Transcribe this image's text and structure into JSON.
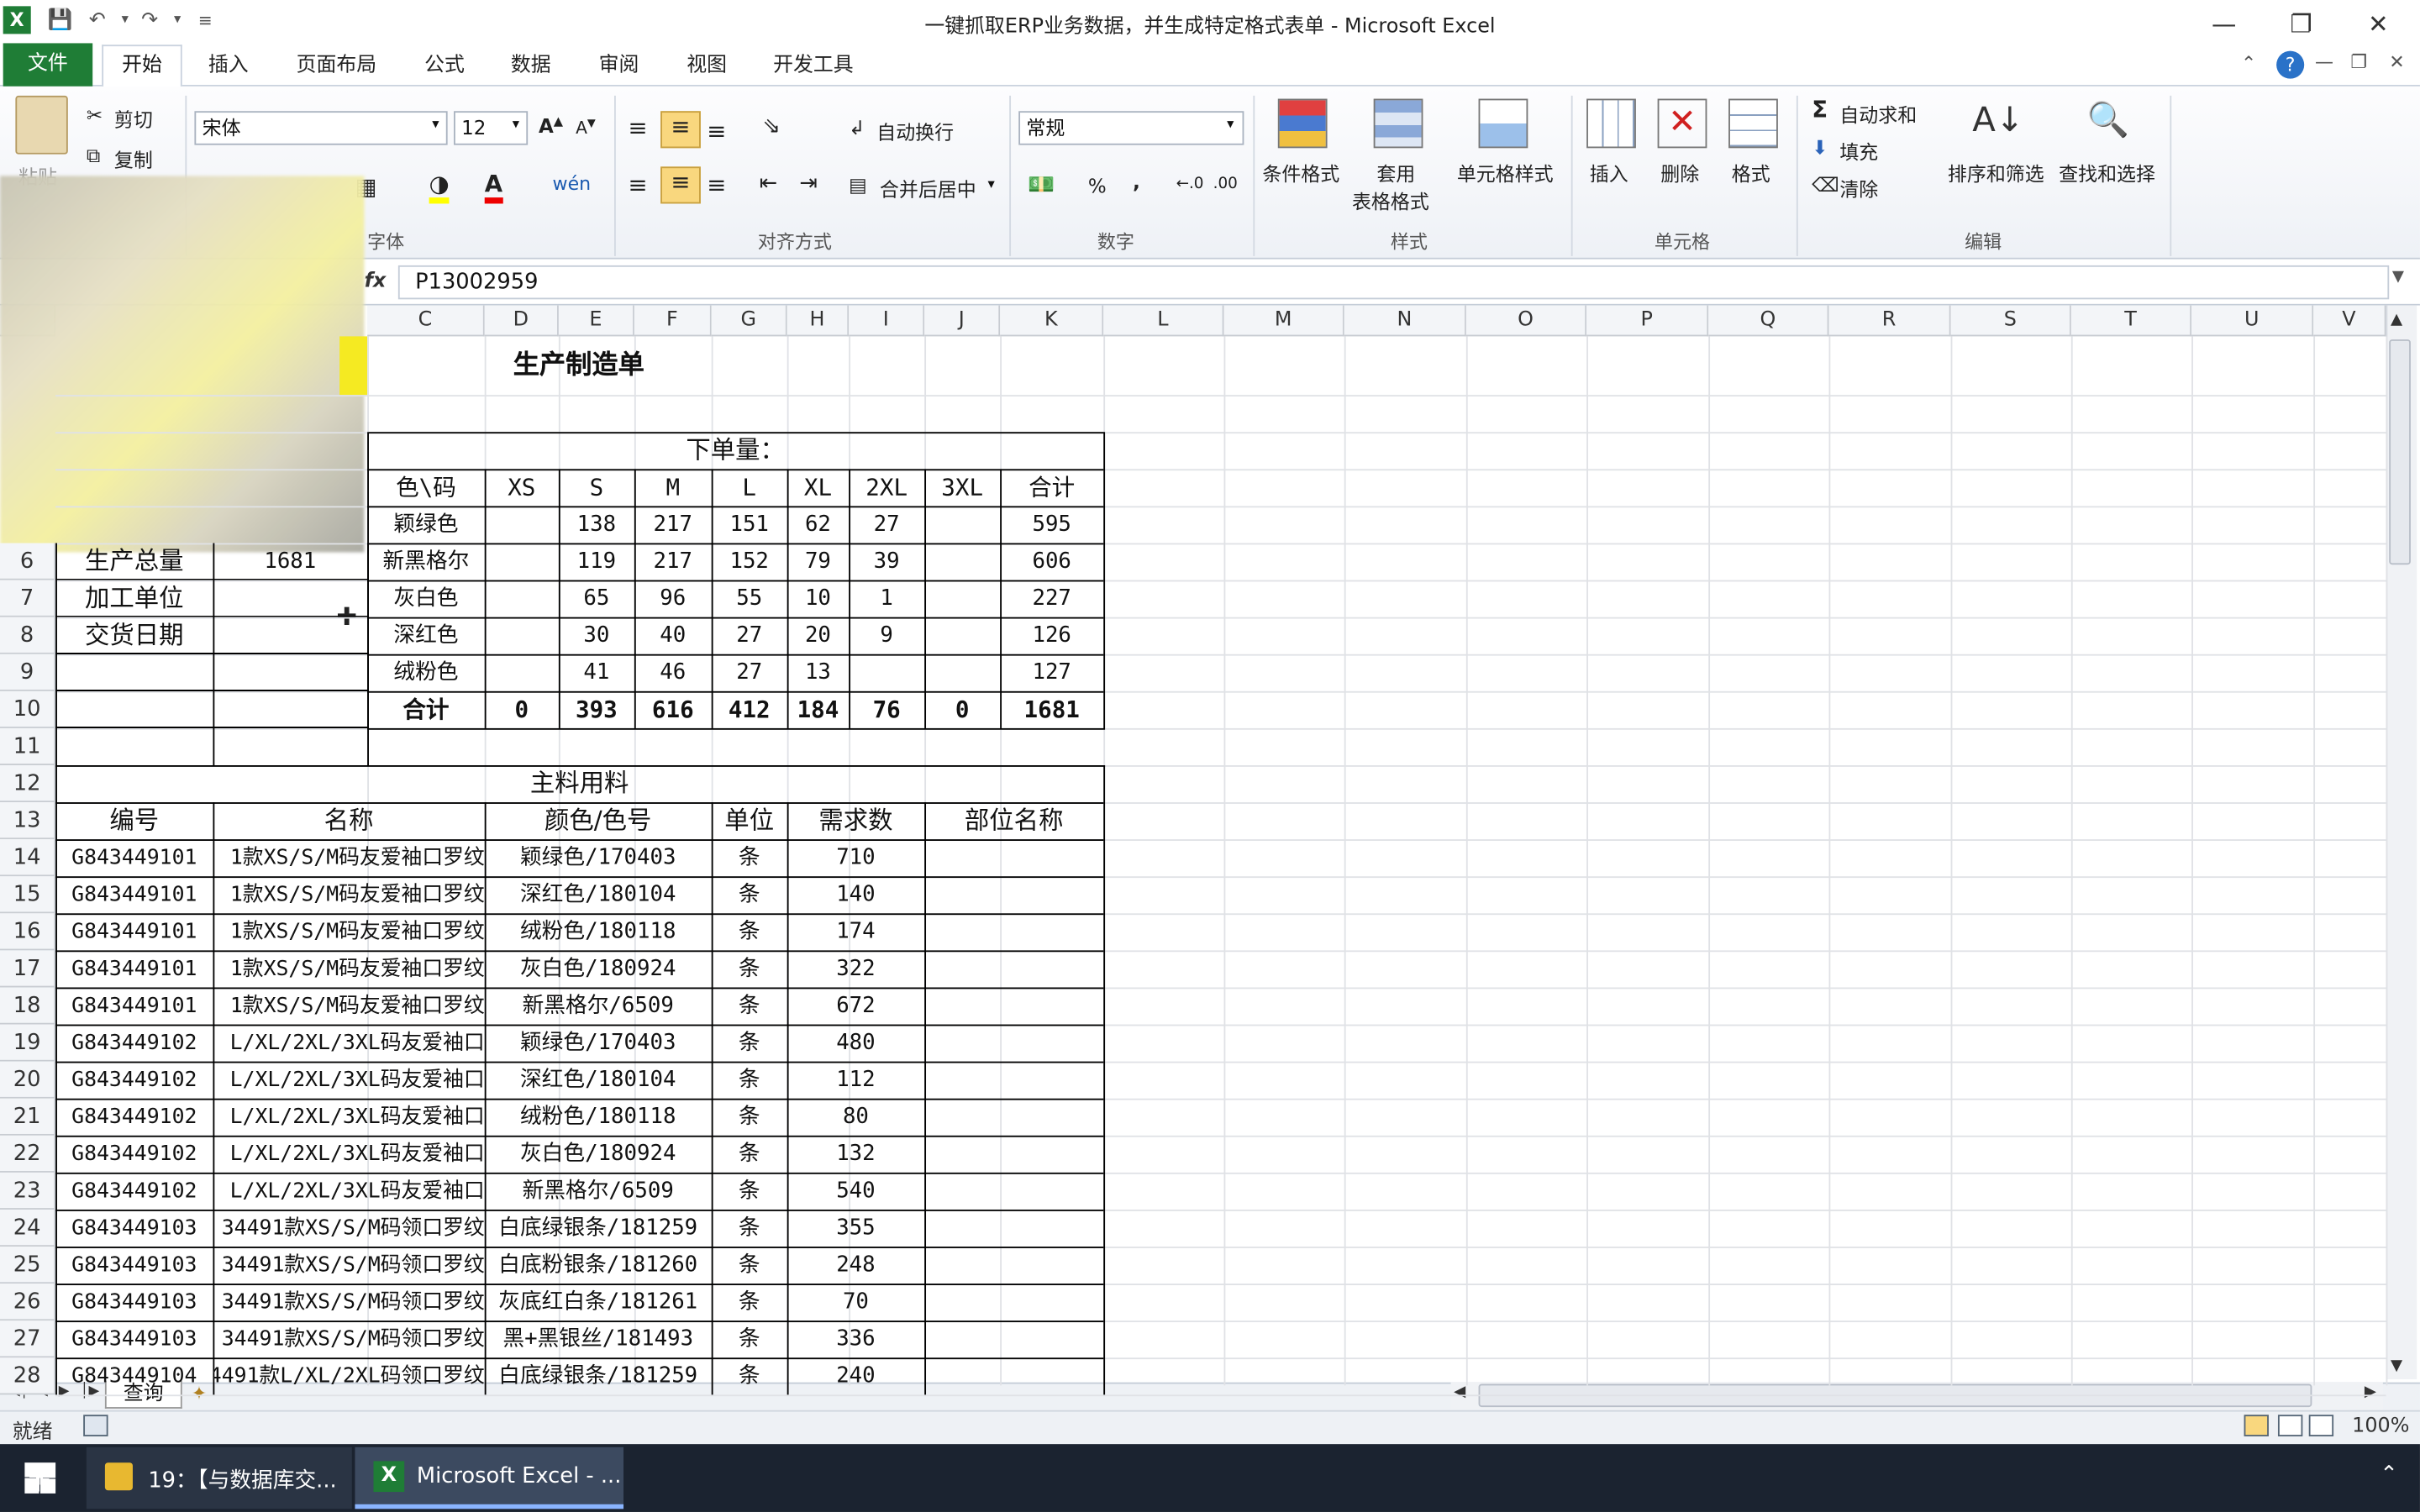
{
  "window": {
    "title": "一键抓取ERP业务数据，并生成特定格式表单 - Microsoft Excel"
  },
  "menu": {
    "file": "文件",
    "tabs": [
      "开始",
      "插入",
      "页面布局",
      "公式",
      "数据",
      "审阅",
      "视图",
      "开发工具"
    ]
  },
  "ribbon": {
    "clipboard": {
      "paste": "粘贴",
      "cut": "剪切",
      "copy": "复制"
    },
    "font": {
      "name": "宋体",
      "size": "12",
      "group": "字体"
    },
    "alignment": {
      "wrap": "自动换行",
      "merge": "合并后居中",
      "group": "对齐方式"
    },
    "number": {
      "format": "常规",
      "percent": "%",
      "comma": ",",
      "group": "数字"
    },
    "styles": {
      "conditional": "条件格式",
      "table_fmt_1": "套用",
      "table_fmt_2": "表格格式",
      "cell_styles": "单元格样式",
      "group": "样式"
    },
    "cells": {
      "insert": "插入",
      "delete": "删除",
      "format": "格式",
      "group": "单元格"
    },
    "editing": {
      "autosum": "自动求和",
      "fill": "填充",
      "clear": "清除",
      "sort": "排序和筛选",
      "find": "查找和选择",
      "group": "编辑"
    }
  },
  "formula_bar": {
    "fx": "fx",
    "value": "P13002959"
  },
  "columns": [
    "C",
    "D",
    "E",
    "F",
    "G",
    "H",
    "I",
    "J",
    "K",
    "L",
    "M",
    "N",
    "O",
    "P",
    "Q",
    "R",
    "S",
    "T",
    "U",
    "V"
  ],
  "rows": [
    "6",
    "7",
    "8",
    "9",
    "10",
    "11",
    "12",
    "13",
    "14",
    "15",
    "16",
    "17",
    "18",
    "19",
    "20",
    "21",
    "22",
    "23",
    "24",
    "25",
    "26",
    "27",
    "28"
  ],
  "sheet": {
    "title": "生产制造单",
    "left_labels": [
      {
        "label": "生产总量",
        "value": "1681"
      },
      {
        "label": "加工单位",
        "value": ""
      },
      {
        "label": "交货日期",
        "value": ""
      }
    ],
    "order": {
      "header": "下单量：",
      "size_header": [
        "色\\码",
        "XS",
        "S",
        "M",
        "L",
        "XL",
        "2XL",
        "3XL",
        "合计"
      ],
      "rows": [
        [
          "颖绿色",
          "",
          "138",
          "217",
          "151",
          "62",
          "27",
          "",
          "595"
        ],
        [
          "新黑格尔",
          "",
          "119",
          "217",
          "152",
          "79",
          "39",
          "",
          "606"
        ],
        [
          "灰白色",
          "",
          "65",
          "96",
          "55",
          "10",
          "1",
          "",
          "227"
        ],
        [
          "深红色",
          "",
          "30",
          "40",
          "27",
          "20",
          "9",
          "",
          "126"
        ],
        [
          "绒粉色",
          "",
          "41",
          "46",
          "27",
          "13",
          "",
          "",
          "127"
        ]
      ],
      "total": [
        "合计",
        "0",
        "393",
        "616",
        "412",
        "184",
        "76",
        "0",
        "1681"
      ]
    },
    "materials": {
      "header": "主料用料",
      "columns": [
        "编号",
        "名称",
        "颜色/色号",
        "单位",
        "需求数",
        "部位名称"
      ],
      "rows": [
        [
          "G843449101",
          "1款XS/S/M码友爱袖口罗纹",
          "颖绿色/170403",
          "条",
          "710",
          ""
        ],
        [
          "G843449101",
          "1款XS/S/M码友爱袖口罗纹",
          "深红色/180104",
          "条",
          "140",
          ""
        ],
        [
          "G843449101",
          "1款XS/S/M码友爱袖口罗纹",
          "绒粉色/180118",
          "条",
          "174",
          ""
        ],
        [
          "G843449101",
          "1款XS/S/M码友爱袖口罗纹",
          "灰白色/180924",
          "条",
          "322",
          ""
        ],
        [
          "G843449101",
          "1款XS/S/M码友爱袖口罗纹",
          "新黑格尔/6509",
          "条",
          "672",
          ""
        ],
        [
          "G843449102",
          "L/XL/2XL/3XL码友爱袖口",
          "颖绿色/170403",
          "条",
          "480",
          ""
        ],
        [
          "G843449102",
          "L/XL/2XL/3XL码友爱袖口",
          "深红色/180104",
          "条",
          "112",
          ""
        ],
        [
          "G843449102",
          "L/XL/2XL/3XL码友爱袖口",
          "绒粉色/180118",
          "条",
          "80",
          ""
        ],
        [
          "G843449102",
          "L/XL/2XL/3XL码友爱袖口",
          "灰白色/180924",
          "条",
          "132",
          ""
        ],
        [
          "G843449102",
          "L/XL/2XL/3XL码友爱袖口",
          "新黑格尔/6509",
          "条",
          "540",
          ""
        ],
        [
          "G843449103",
          "34491款XS/S/M码领口罗纹",
          "白底绿银条/181259",
          "条",
          "355",
          ""
        ],
        [
          "G843449103",
          "34491款XS/S/M码领口罗纹",
          "白底粉银条/181260",
          "条",
          "248",
          ""
        ],
        [
          "G843449103",
          "34491款XS/S/M码领口罗纹",
          "灰底红白条/181261",
          "条",
          "70",
          ""
        ],
        [
          "G843449103",
          "34491款XS/S/M码领口罗纹",
          "黑+黑银丝/181493",
          "条",
          "336",
          ""
        ],
        [
          "G843449104",
          "4491款L/XL/2XL码领口罗纹",
          "白底绿银条/181259",
          "条",
          "240",
          ""
        ]
      ]
    }
  },
  "sheet_tab": "查询",
  "status": {
    "ready": "就绪",
    "zoom": "100%"
  },
  "taskbar": {
    "folder": "19：【与数据库交...",
    "excel": "Microsoft Excel - ..."
  }
}
